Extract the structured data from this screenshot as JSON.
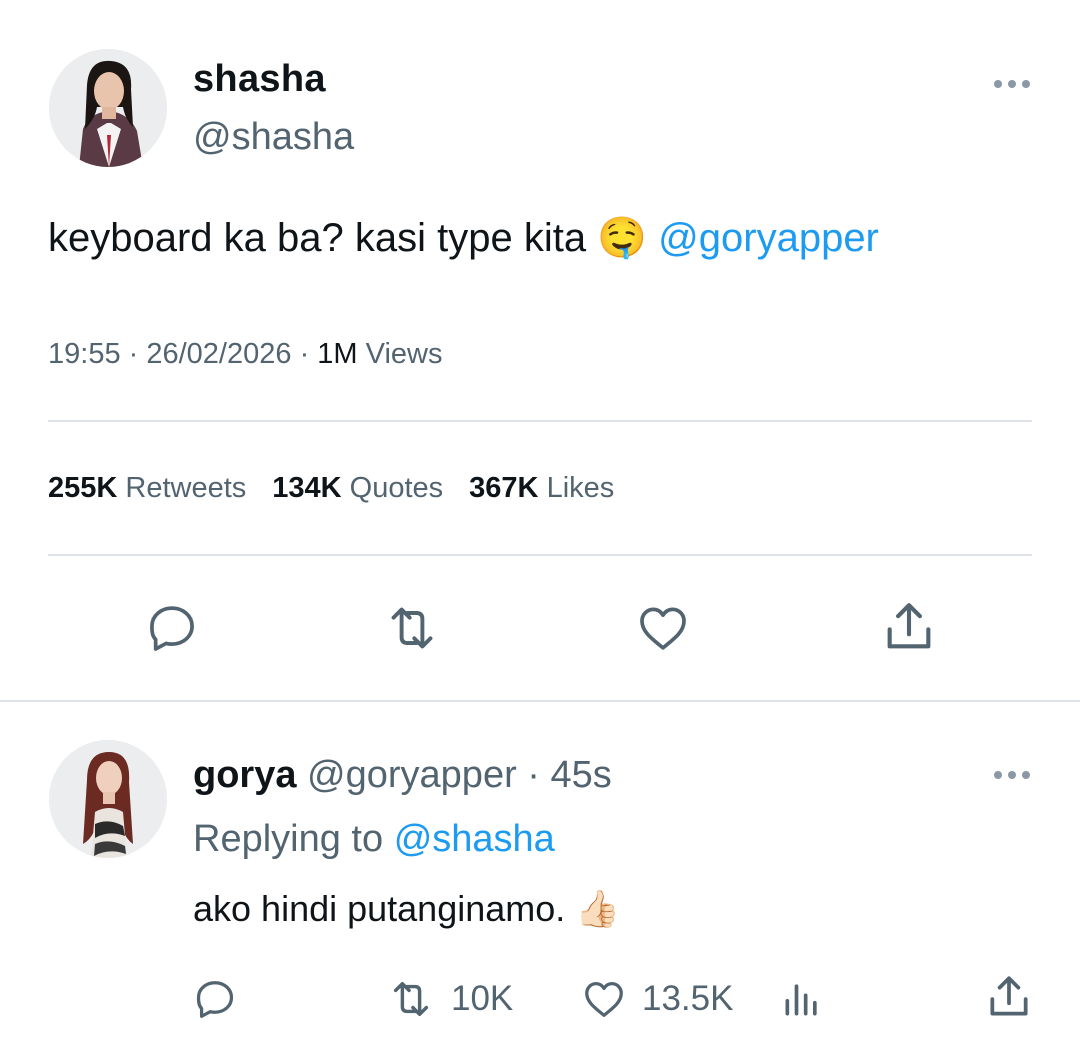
{
  "main_tweet": {
    "author_name": "shasha",
    "author_handle": "@shasha",
    "text": "keyboard ka ba? kasi type kita",
    "emoji": "🤤",
    "mention": "@goryapper",
    "time": "19:55",
    "date": "26/02/2026",
    "views_count": "1M",
    "views_label": "Views",
    "retweets_count": "255K",
    "retweets_label": "Retweets",
    "quotes_count": "134K",
    "quotes_label": "Quotes",
    "likes_count": "367K",
    "likes_label": "Likes",
    "actions": [
      "reply-icon",
      "retweet-icon",
      "like-icon",
      "share-icon"
    ]
  },
  "reply": {
    "author_name": "gorya",
    "author_handle": "@goryapper",
    "age": "45s",
    "replying_label": "Replying to",
    "replying_to": "@shasha",
    "text": "ako hindi putanginamo.",
    "emoji": "👍🏻",
    "retweets_count": "10K",
    "likes_count": "13.5K",
    "actions": [
      "reply-icon",
      "retweet-icon",
      "like-icon",
      "views-chart-icon",
      "share-icon"
    ]
  },
  "colors": {
    "text": "#0f1419",
    "secondary": "#536471",
    "link": "#1d9bf0",
    "divider": "#dde3e8",
    "icon": "#536471"
  }
}
